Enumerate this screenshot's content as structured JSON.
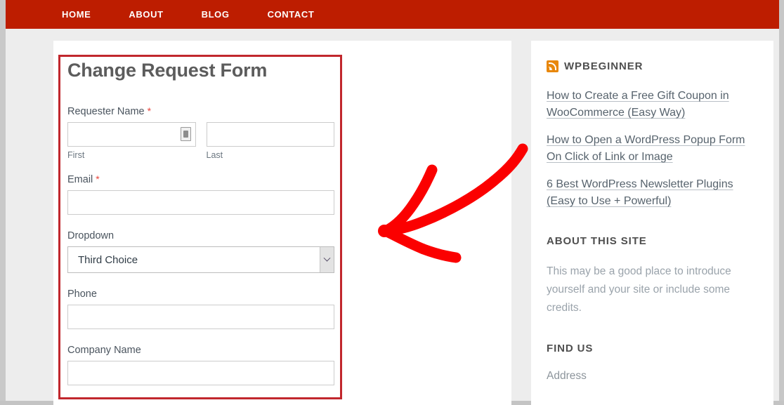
{
  "navbar": {
    "background": "#bd1d00",
    "links": [
      {
        "label": "HOME"
      },
      {
        "label": "ABOUT"
      },
      {
        "label": "BLOG"
      },
      {
        "label": "CONTACT"
      }
    ]
  },
  "form": {
    "title": "Change Request Form",
    "required_marker": "*",
    "fields": [
      {
        "label": "Requester Name",
        "required": true,
        "type": "name",
        "first": {
          "value": "",
          "sublabel": "First",
          "icon": "contact-card-autofill-icon"
        },
        "last": {
          "value": "",
          "sublabel": "Last"
        }
      },
      {
        "label": "Email",
        "required": true,
        "type": "text",
        "value": ""
      },
      {
        "label": "Dropdown",
        "required": false,
        "type": "select",
        "value": "Third Choice",
        "icon": "chevron-down-icon"
      },
      {
        "label": "Phone",
        "required": false,
        "type": "text",
        "value": ""
      },
      {
        "label": "Company Name",
        "required": false,
        "type": "text",
        "value": ""
      }
    ]
  },
  "sidebar": {
    "feed_widget": {
      "title": "WPBEGINNER",
      "icon": "rss-feed-icon",
      "icon_color": "#e8870b",
      "items": [
        {
          "text": "How to Create a Free Gift Coupon in WooCommerce (Easy Way)"
        },
        {
          "text": "How to Open a WordPress Popup Form On Click of Link or Image"
        },
        {
          "text": "6 Best WordPress Newsletter Plugins (Easy to Use + Powerful)"
        }
      ]
    },
    "about_widget": {
      "title": "ABOUT THIS SITE",
      "body": "This may be a good place to introduce yourself and your site or include some credits."
    },
    "find_us_widget": {
      "title": "FIND US",
      "body": "Address"
    }
  },
  "annotations": {
    "highlight_box": {
      "color": "#c1272d",
      "name": "form-highlight-rectangle"
    },
    "arrow": {
      "color": "#fb0000",
      "name": "pointer-arrow",
      "direction": "left"
    }
  }
}
